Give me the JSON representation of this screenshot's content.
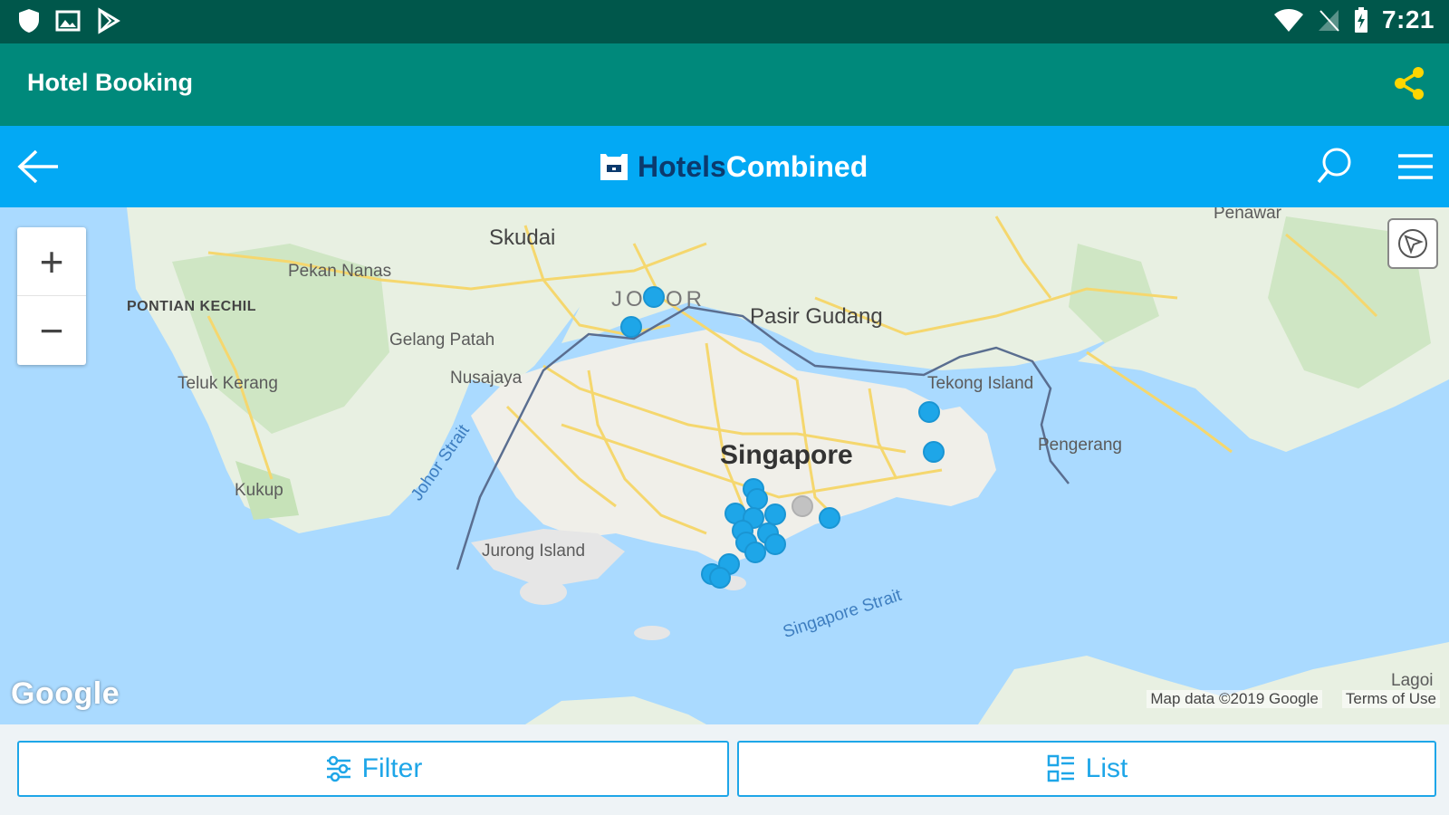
{
  "status_bar": {
    "time": "7:21",
    "icons_left": [
      "shield-icon",
      "image-icon",
      "play-store-icon"
    ],
    "icons_right": [
      "wifi-icon",
      "no-signal-icon",
      "battery-charging-icon"
    ]
  },
  "app_bar": {
    "title": "Hotel Booking",
    "share_icon": "share-icon",
    "share_color": "#ffd600"
  },
  "web_header": {
    "brand_part1": "Hotels",
    "brand_part2": "Combined",
    "back_icon": "arrow-left-icon",
    "search_icon": "search-icon",
    "menu_icon": "hamburger-menu-icon"
  },
  "map": {
    "labels": {
      "skudai": "Skudai",
      "pekan_nanas": "Pekan Nanas",
      "pontian_kechil": "PONTIAN KECHIL",
      "johor": "JOHOR",
      "pasir_gudang": "Pasir Gudang",
      "gelang_patah": "Gelang Patah",
      "nusajaya": "Nusajaya",
      "teluk_kerang": "Teluk Kerang",
      "tekong_island": "Tekong Island",
      "singapore": "Singapore",
      "pengerang": "Pengerang",
      "kukup": "Kukup",
      "johor_strait": "Johor Strait",
      "jurong_island": "Jurong Island",
      "singapore_strait": "Singapore Strait",
      "penawar": "Penawar",
      "lagoi": "Lagoi"
    },
    "zoom_in": "+",
    "zoom_out": "−",
    "google": "Google",
    "map_data": "Map data ©2019 Google",
    "terms": "Terms of Use",
    "pin_color": "#1ea6e8"
  },
  "bottom_bar": {
    "filter_label": "Filter",
    "list_label": "List"
  }
}
